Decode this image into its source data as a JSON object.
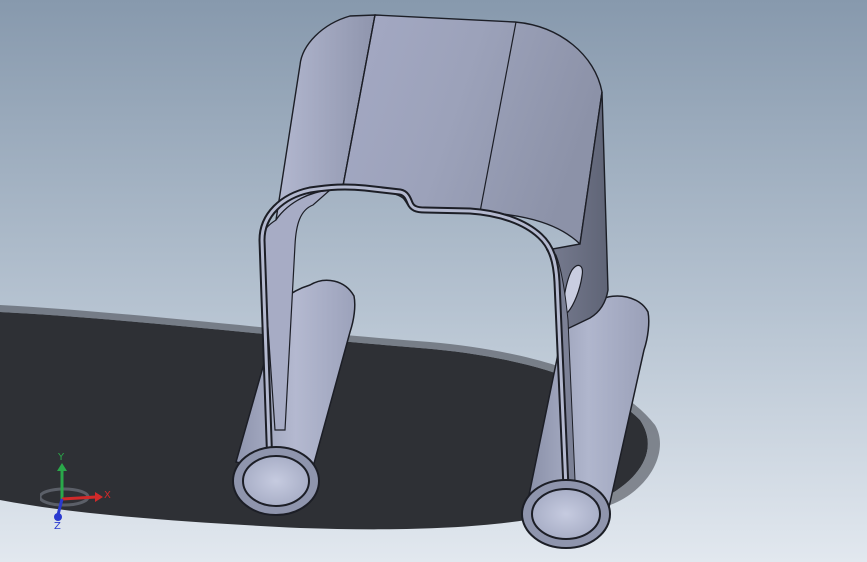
{
  "viewport": {
    "background_top_color": "#8a9cb0",
    "background_bottom_color": "#dfe6ee",
    "shadow_color": "#2a2c31",
    "part_color": "#9aa0b8",
    "part_edge_color": "#1a1c24"
  },
  "triad": {
    "x_label": "X",
    "y_label": "Y",
    "z_label": "Z",
    "x_color": "#d02a2a",
    "y_color": "#2aa84a",
    "z_color": "#2a3ad0"
  }
}
